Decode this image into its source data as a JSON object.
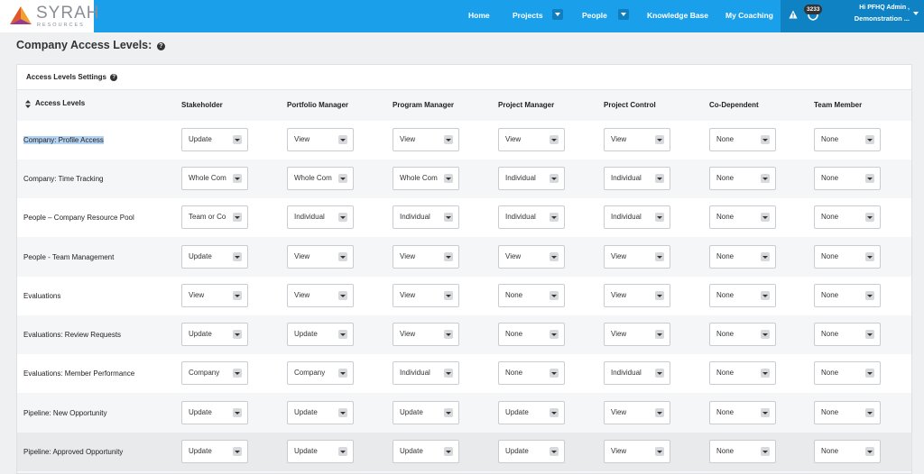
{
  "brand": {
    "name": "SYRAH",
    "tagline": "RESOURCES"
  },
  "nav": {
    "items": [
      {
        "label": "Home"
      },
      {
        "label": "Projects"
      },
      {
        "label": "People"
      },
      {
        "label": "Knowledge Base"
      },
      {
        "label": "My Coaching"
      }
    ],
    "notifications_count": "3233",
    "user_greeting": "Hi PFHQ Admin ,",
    "user_org": "Demonstration ..."
  },
  "page": {
    "title": "Company Access Levels:"
  },
  "panel": {
    "title": "Access Levels Settings"
  },
  "table": {
    "columns": [
      "Access Levels",
      "Stakeholder",
      "Portfolio Manager",
      "Program Manager",
      "Project Manager",
      "Project Control",
      "Co-Dependent",
      "Team Member"
    ],
    "rows": [
      {
        "label": "Company: Profile Access",
        "values": [
          "Update",
          "View",
          "View",
          "View",
          "View",
          "None",
          "None"
        ]
      },
      {
        "label": "Company: Time Tracking",
        "values": [
          "Whole Com",
          "Whole Com",
          "Whole Com",
          "Individual",
          "Individual",
          "None",
          "None"
        ]
      },
      {
        "label": "People – Company Resource Pool",
        "values": [
          "Team or Co",
          "Individual",
          "Individual",
          "Individual",
          "Individual",
          "None",
          "None"
        ]
      },
      {
        "label": "People - Team Management",
        "values": [
          "Update",
          "View",
          "View",
          "View",
          "View",
          "None",
          "None"
        ]
      },
      {
        "label": "Evaluations",
        "values": [
          "View",
          "View",
          "View",
          "None",
          "View",
          "None",
          "None"
        ]
      },
      {
        "label": "Evaluations: Review Requests",
        "values": [
          "Update",
          "Update",
          "View",
          "None",
          "View",
          "None",
          "None"
        ]
      },
      {
        "label": "Evaluations: Member Performance",
        "values": [
          "Company",
          "Company",
          "Individual",
          "None",
          "Individual",
          "None",
          "None"
        ]
      },
      {
        "label": "Pipeline: New Opportunity",
        "values": [
          "Update",
          "Update",
          "Update",
          "Update",
          "View",
          "None",
          "None"
        ]
      },
      {
        "label": "Pipeline: Approved Opportunity",
        "values": [
          "Update",
          "Update",
          "Update",
          "Update",
          "View",
          "None",
          "None"
        ]
      }
    ]
  },
  "colors": {
    "nav_bg": "#1aa0ea",
    "user_panel_bg": "#0f82c4",
    "highlight": "#b5d4f4"
  }
}
